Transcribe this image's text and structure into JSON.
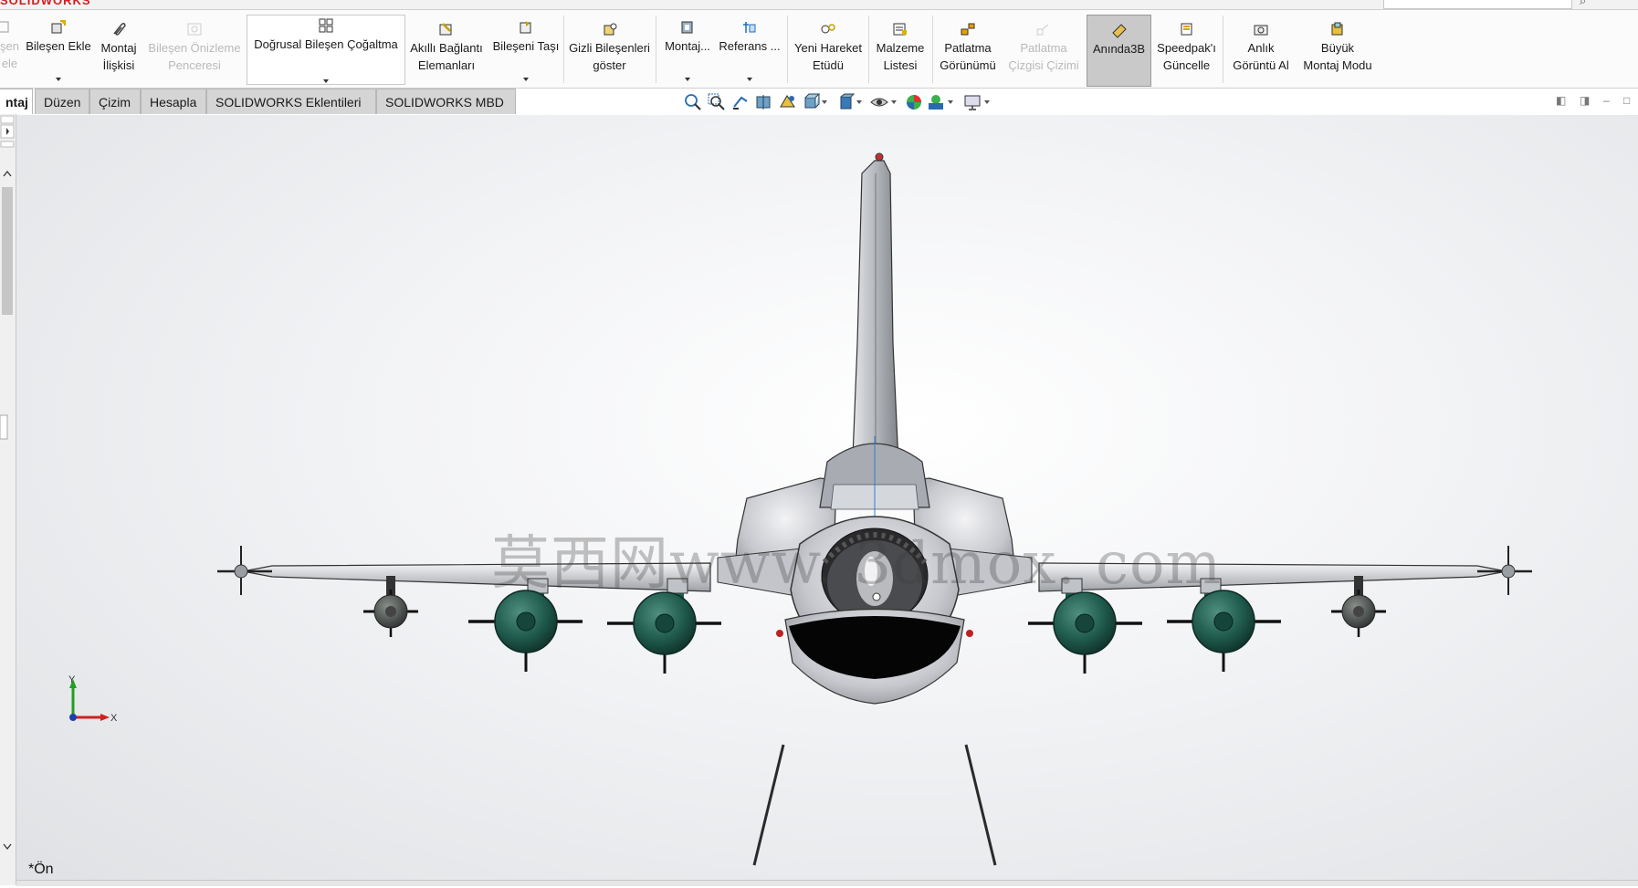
{
  "app": {
    "logo_text": "SOLIDWORKS"
  },
  "ribbon": {
    "tools": [
      {
        "label": "…şen\n…ele",
        "icon": "component-icon",
        "disabled": true
      },
      {
        "label": "Bileşen Ekle",
        "icon": "insert-component-icon",
        "dropdown": true
      },
      {
        "label": "Montaj\nİlişkisi",
        "icon": "mate-paperclip-icon"
      },
      {
        "label": "Bileşen Önizleme\nPenceresi",
        "icon": "component-preview-icon",
        "disabled": true
      },
      {
        "label": "Doğrusal Bileşen Çoğaltma",
        "icon": "linear-pattern-icon",
        "dropdown": true
      },
      {
        "label": "Akıllı Bağlantı\nElemanları",
        "icon": "smart-fasteners-icon"
      },
      {
        "label": "Bileşeni Taşı",
        "icon": "move-component-icon",
        "dropdown": true
      },
      {
        "label": "Gizli Bileşenleri\ngöster",
        "icon": "show-hidden-icon"
      },
      {
        "label": "Montaj...",
        "icon": "assembly-features-icon",
        "dropdown": true
      },
      {
        "label": "Referans ...",
        "icon": "reference-geometry-icon",
        "dropdown": true
      },
      {
        "label": "Yeni Hareket\nEtüdü",
        "icon": "motion-study-icon"
      },
      {
        "label": "Malzeme\nListesi",
        "icon": "bill-of-materials-icon"
      },
      {
        "label": "Patlatma\nGörünümü",
        "icon": "exploded-view-icon"
      },
      {
        "label": "Patlatma\nÇizgisi Çizimi",
        "icon": "explode-line-icon",
        "disabled": true
      },
      {
        "label": "Anında3B",
        "icon": "instant3d-icon",
        "active": true
      },
      {
        "label": "Speedpak'ı\nGüncelle",
        "icon": "speedpak-icon"
      },
      {
        "label": "Anlık\nGörüntü Al",
        "icon": "camera-icon"
      },
      {
        "label": "Büyük\nMontaj Modu",
        "icon": "large-assembly-icon"
      }
    ]
  },
  "tabs": [
    "ntaj",
    "Düzen",
    "Çizim",
    "Hesapla",
    "SOLIDWORKS Eklentileri",
    "SOLIDWORKS MBD"
  ],
  "heads_up_toolbar": [
    "zoom-to-fit-icon",
    "zoom-area-icon",
    "previous-view-icon",
    "section-view-icon",
    "dynamic-annotation-icon",
    "view-orientation-icon",
    "display-style-icon",
    "hide-show-icon",
    "edit-appearance-icon",
    "apply-scene-icon",
    "view-settings-icon"
  ],
  "viewport": {
    "watermark": "莫西网www. 3dmox. com",
    "view_name": "*Ön",
    "triad": {
      "y": "Y",
      "x": "X"
    }
  },
  "colors": {
    "accent_red": "#d21e1e",
    "active_tool_bg": "#c9c9c9",
    "store_green": "#1f5a4c",
    "triad_x": "#d02020",
    "triad_y": "#20a020"
  }
}
